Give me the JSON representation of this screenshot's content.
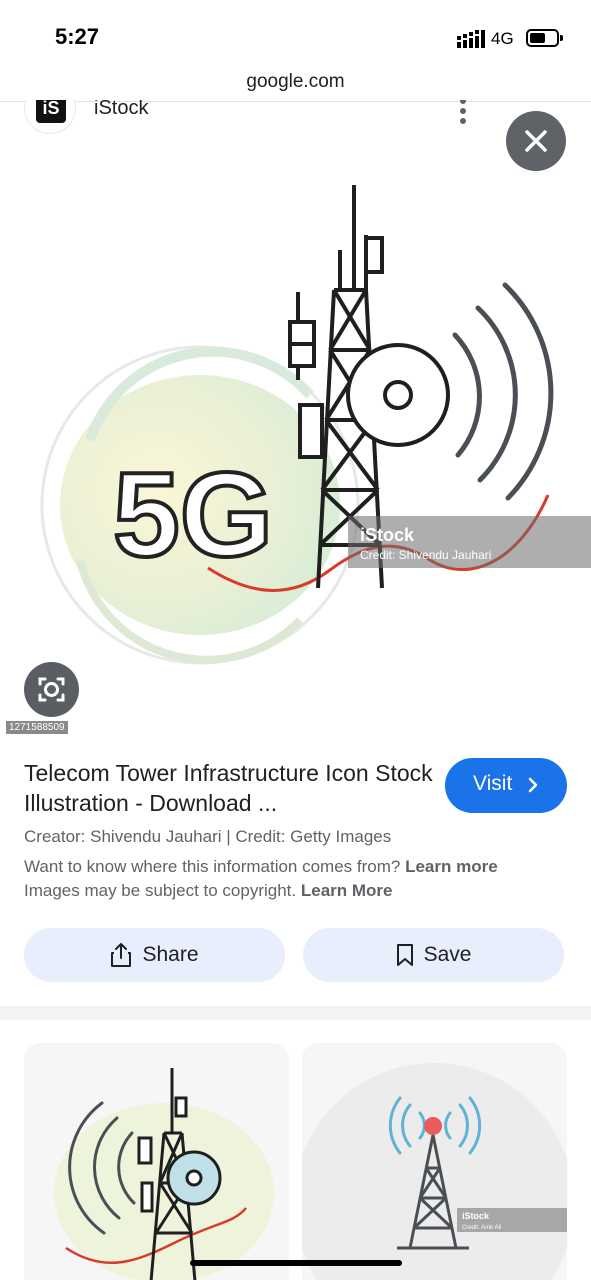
{
  "status_bar": {
    "time": "5:27",
    "network": "4G"
  },
  "browser": {
    "url": "google.com"
  },
  "source": {
    "logo_text": "iS",
    "name": "iStock"
  },
  "image": {
    "main_text": "5G",
    "watermark_brand": "iStock",
    "watermark_credit": "Credit: Shivendu Jauhari",
    "image_id": "1271588509"
  },
  "result": {
    "title": "Telecom Tower Infrastructure Icon Stock Illustration - Download ...",
    "visit_label": "Visit",
    "creator_line": "Creator: Shivendu Jauhari | Credit: Getty Images",
    "info_text": "Want to know where this information comes from?",
    "info_link": "Learn more",
    "copyright_text": "Images may be subject to copyright.",
    "copyright_link": "Learn More",
    "share_label": "Share",
    "save_label": "Save"
  },
  "related": [
    {
      "watermark_brand": "",
      "watermark_credit": ""
    },
    {
      "watermark_brand": "iStock",
      "watermark_credit": "Credit: Amir Ali"
    }
  ],
  "colors": {
    "accent": "#1a73e8",
    "button_bg": "#e8eefc",
    "wave_red": "#d93a2b"
  }
}
